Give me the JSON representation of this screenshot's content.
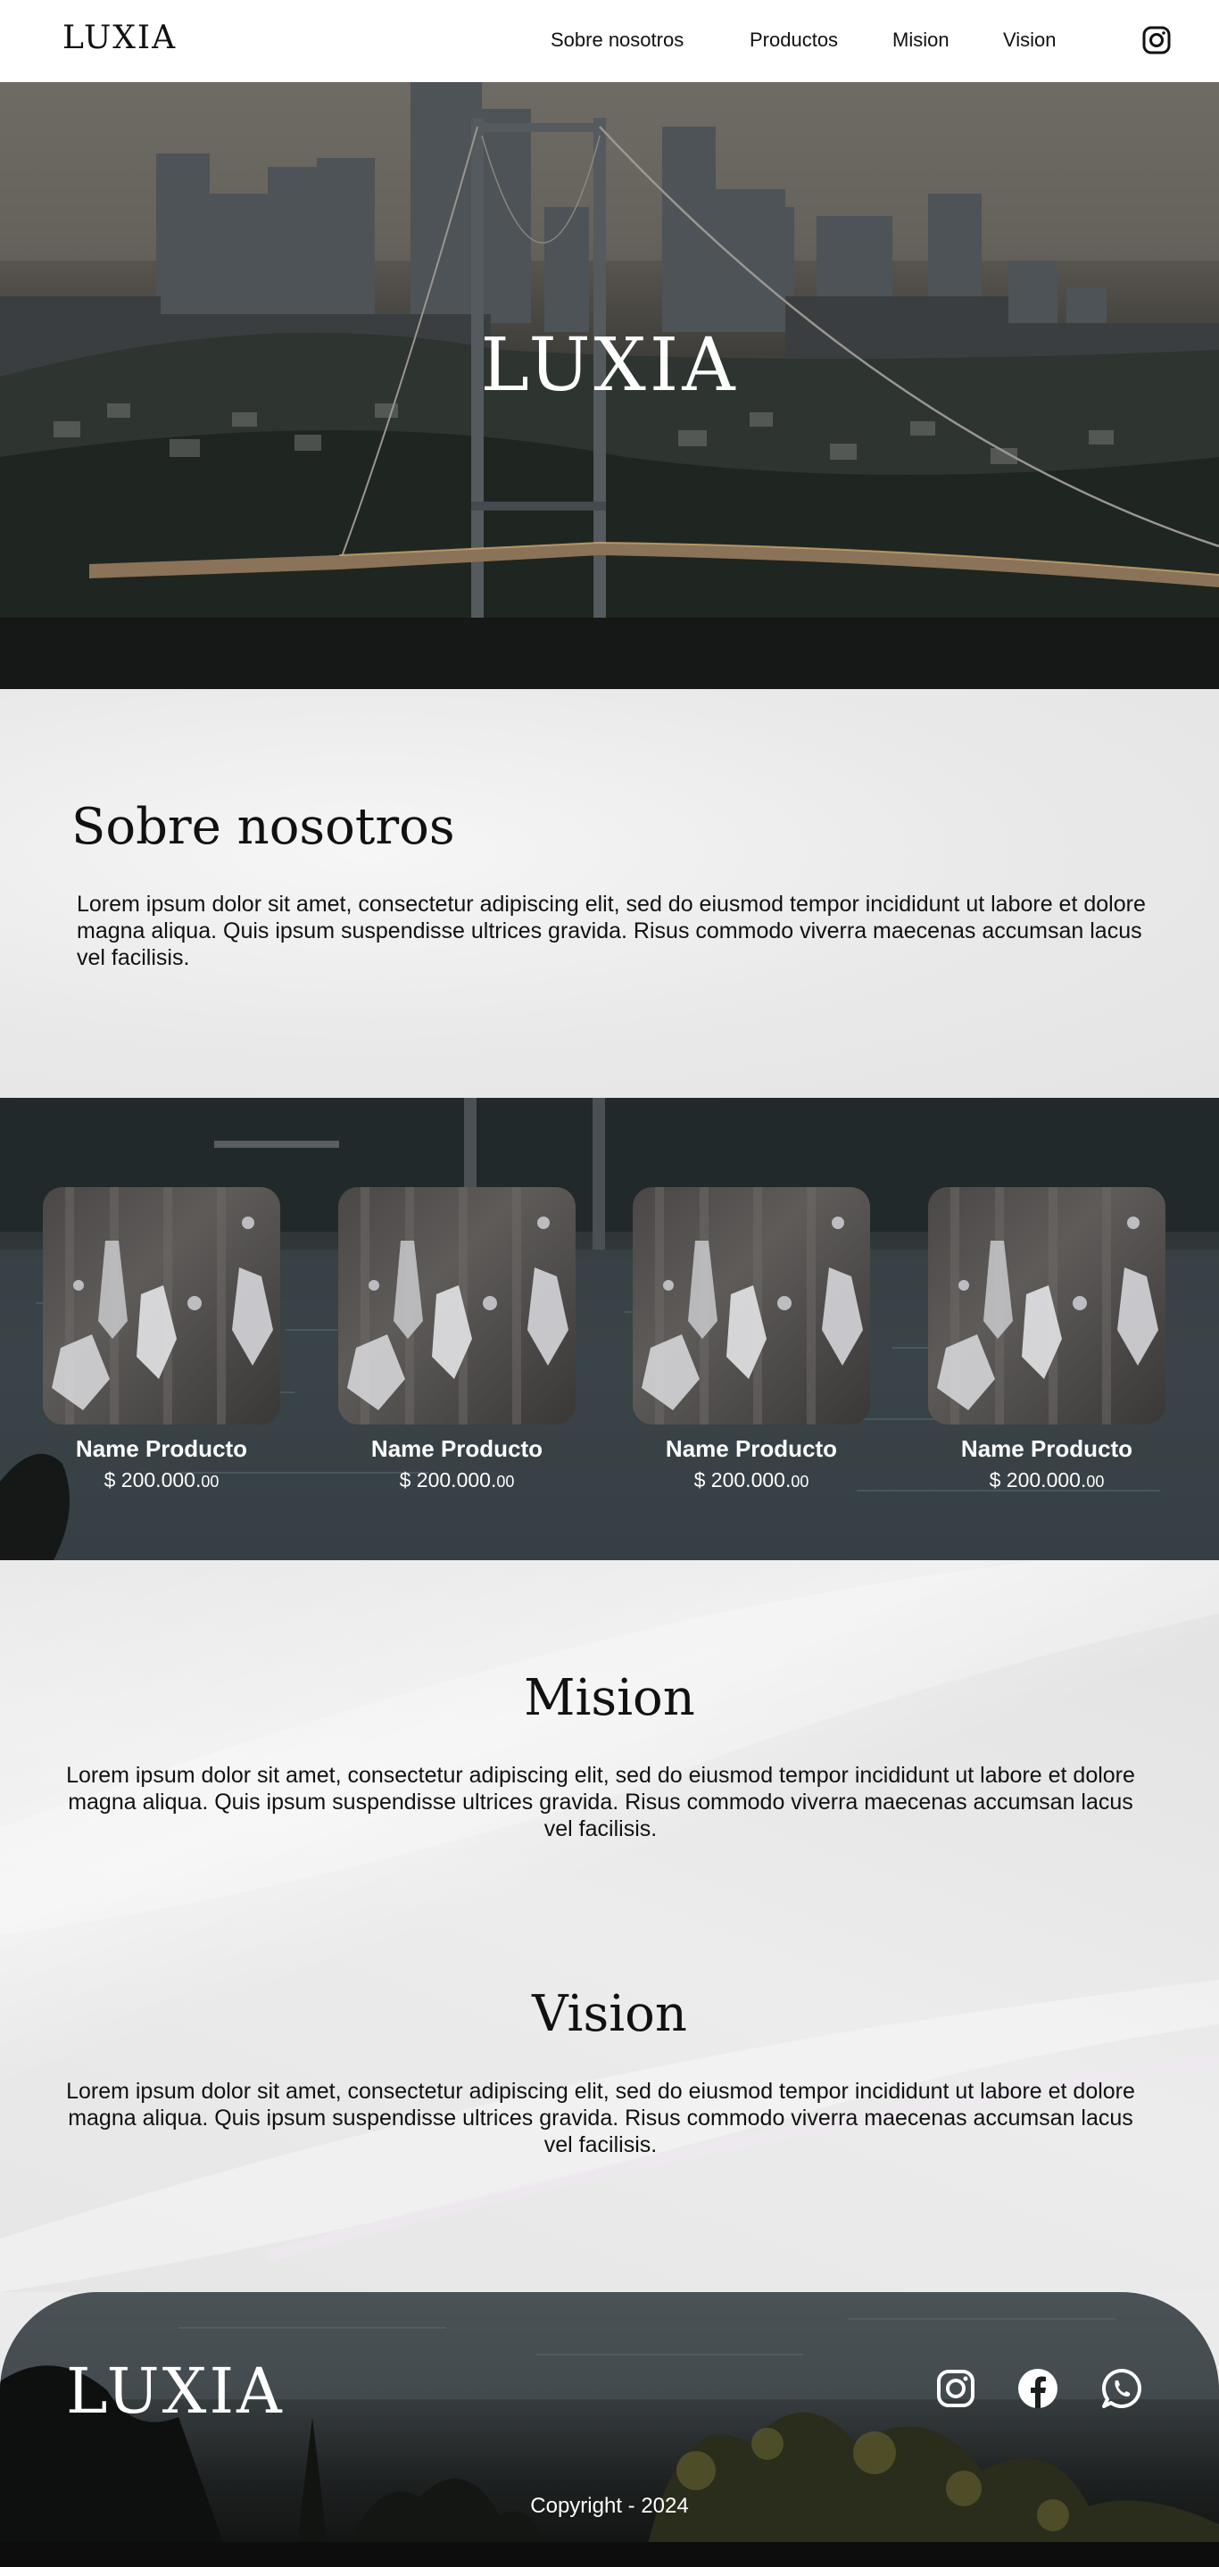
{
  "nav": {
    "logo": "LUXIA",
    "links": [
      "Sobre nosotros",
      "Productos",
      "Mision",
      "Vision"
    ],
    "instagram_icon": "instagram-icon"
  },
  "hero": {
    "title": "LUXIA"
  },
  "about": {
    "title": "Sobre nosotros",
    "text": "Lorem ipsum dolor sit amet, consectetur adipiscing elit, sed do eiusmod tempor incididunt ut labore et dolore magna aliqua. Quis ipsum suspendisse ultrices gravida. Risus commodo viverra maecenas accumsan lacus vel facilisis."
  },
  "products": [
    {
      "name": "Name Producto",
      "price_main": "$ 200.000.",
      "price_cents": "00"
    },
    {
      "name": "Name Producto",
      "price_main": "$ 200.000.",
      "price_cents": "00"
    },
    {
      "name": "Name Producto",
      "price_main": "$ 200.000.",
      "price_cents": "00"
    },
    {
      "name": "Name Producto",
      "price_main": "$ 200.000.",
      "price_cents": "00"
    }
  ],
  "mission": {
    "title": "Mision",
    "text": "Lorem ipsum dolor sit amet, consectetur adipiscing elit, sed do eiusmod tempor incididunt ut labore et dolore magna aliqua. Quis ipsum suspendisse ultrices gravida. Risus commodo viverra maecenas accumsan lacus vel facilisis."
  },
  "vision": {
    "title": "Vision",
    "text": "Lorem ipsum dolor sit amet, consectetur adipiscing elit, sed do eiusmod tempor incididunt ut labore et dolore magna aliqua. Quis ipsum suspendisse ultrices gravida. Risus commodo viverra maecenas accumsan lacus vel facilisis."
  },
  "footer": {
    "logo": "LUXIA",
    "social_icons": [
      "instagram-icon",
      "facebook-icon",
      "whatsapp-icon"
    ],
    "copyright": "Copyright - 2024"
  },
  "colors": {
    "navbar_bg": "#ffffff",
    "light_section_bg": "#ebebeb",
    "text_dark": "#111111",
    "text_light": "#ffffff"
  }
}
